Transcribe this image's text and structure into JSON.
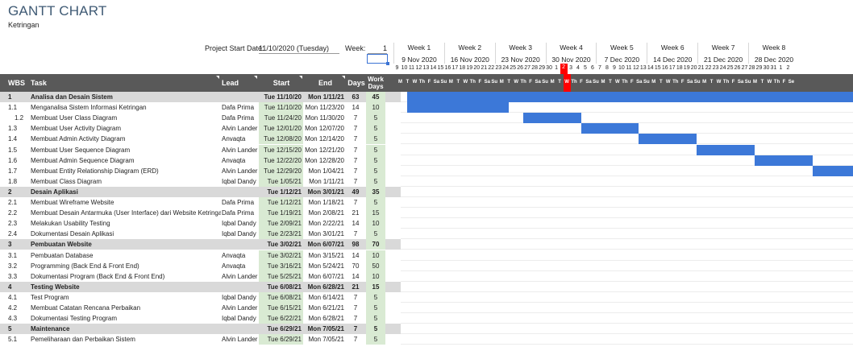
{
  "header": {
    "title": "GANTT CHART",
    "subtitle": "Ketringan",
    "project_start_label": "Project Start Date:",
    "project_start_value": "11/10/2020 (Tuesday)",
    "week_label": "Week:",
    "week_value": "1"
  },
  "weeks": [
    {
      "name": "Week 1",
      "date": "9 Nov 2020"
    },
    {
      "name": "Week 2",
      "date": "16 Nov 2020"
    },
    {
      "name": "Week 3",
      "date": "23 Nov 2020"
    },
    {
      "name": "Week 4",
      "date": "30 Nov 2020"
    },
    {
      "name": "Week 5",
      "date": "7 Dec 2020"
    },
    {
      "name": "Week 6",
      "date": "14 Dec 2020"
    },
    {
      "name": "Week 7",
      "date": "21 Dec 2020"
    },
    {
      "name": "Week 8",
      "date": "28 Dec 2020"
    }
  ],
  "day_numbers": [
    "9",
    "10",
    "11",
    "12",
    "13",
    "14",
    "15",
    "16",
    "17",
    "18",
    "19",
    "20",
    "21",
    "22",
    "23",
    "24",
    "25",
    "26",
    "27",
    "28",
    "29",
    "30",
    "1",
    "2",
    "3",
    "4",
    "5",
    "6",
    "7",
    "8",
    "9",
    "10",
    "11",
    "12",
    "13",
    "14",
    "15",
    "16",
    "17",
    "18",
    "19",
    "20",
    "21",
    "22",
    "23",
    "24",
    "25",
    "26",
    "27",
    "28",
    "29",
    "30",
    "31",
    "1",
    "2"
  ],
  "day_letters": [
    "M",
    "T",
    "W",
    "Th",
    "F",
    "Sa",
    "Su",
    "M",
    "T",
    "W",
    "Th",
    "F",
    "Sa",
    "Su",
    "M",
    "T",
    "W",
    "Th",
    "F",
    "Sa",
    "Su",
    "M",
    "T",
    "W",
    "Th",
    "F",
    "Sa",
    "Su",
    "M",
    "T",
    "W",
    "Th",
    "F",
    "Sa",
    "Su",
    "M",
    "T",
    "W",
    "Th",
    "F",
    "Sa",
    "Su",
    "M",
    "T",
    "W",
    "Th",
    "F",
    "Sa",
    "Su",
    "M",
    "T",
    "W",
    "Th",
    "F",
    "Se"
  ],
  "today_index": 23,
  "columns": {
    "wbs": "WBS",
    "task": "Task",
    "lead": "Lead",
    "start": "Start",
    "end": "End",
    "days": "Days",
    "work_days": "Work Days"
  },
  "rows": [
    {
      "wbs": "1",
      "task": "Analisa dan Desain Sistem",
      "lead": "",
      "start": "Tue 11/10/20",
      "end": "Mon 1/11/21",
      "days": "63",
      "work": "45",
      "phase": true
    },
    {
      "wbs": "1.1",
      "task": "Menganalisa Sistem Informasi Ketringan",
      "lead": "Dafa Prima",
      "start": "Tue 11/10/20",
      "end": "Mon 11/23/20",
      "days": "14",
      "work": "10",
      "bar_start": 0,
      "bar_len": 14
    },
    {
      "wbs": "1.2",
      "task": "Membuat User Class Diagram",
      "lead": "Dafa Prima",
      "start": "Tue 11/24/20",
      "end": "Mon 11/30/20",
      "days": "7",
      "work": "5",
      "bar_start": 16,
      "bar_len": 8,
      "indent": true
    },
    {
      "wbs": "1.3",
      "task": "Membuat User Activity Diagram",
      "lead": "Alvin Lander",
      "start": "Tue 12/01/20",
      "end": "Mon 12/07/20",
      "days": "7",
      "work": "5",
      "bar_start": 24,
      "bar_len": 8
    },
    {
      "wbs": "1.4",
      "task": "Membuat Admin Activity Diagram",
      "lead": "Anvaqta",
      "start": "Tue 12/08/20",
      "end": "Mon 12/14/20",
      "days": "7",
      "work": "5",
      "bar_start": 32,
      "bar_len": 8
    },
    {
      "wbs": "1.5",
      "task": "Membuat User Sequence Diagram",
      "lead": "Alvin Lander",
      "start": "Tue 12/15/20",
      "end": "Mon 12/21/20",
      "days": "7",
      "work": "5",
      "bar_start": 40,
      "bar_len": 8
    },
    {
      "wbs": "1.6",
      "task": "Membuat Admin Sequence Diagram",
      "lead": "Anvaqta",
      "start": "Tue 12/22/20",
      "end": "Mon 12/28/20",
      "days": "7",
      "work": "5",
      "bar_start": 48,
      "bar_len": 8
    },
    {
      "wbs": "1.7",
      "task": "Membuat Entity Relationship Diagram (ERD)",
      "lead": "Alvin Lander",
      "start": "Tue 12/29/20",
      "end": "Mon 1/04/21",
      "days": "7",
      "work": "5",
      "bar_start": 56,
      "bar_len": 6
    },
    {
      "wbs": "1.8",
      "task": "Membuat Class Diagram",
      "lead": "Iqbal Dandy",
      "start": "Tue 1/05/21",
      "end": "Mon 1/11/21",
      "days": "7",
      "work": "5"
    },
    {
      "wbs": "2",
      "task": "Desain Aplikasi",
      "lead": "",
      "start": "Tue 1/12/21",
      "end": "Mon 3/01/21",
      "days": "49",
      "work": "35",
      "phase": true
    },
    {
      "wbs": "2.1",
      "task": "Membuat Wireframe Website",
      "lead": "Dafa Prima",
      "start": "Tue 1/12/21",
      "end": "Mon 1/18/21",
      "days": "7",
      "work": "5"
    },
    {
      "wbs": "2.2",
      "task": "Membuat Desain Antarmuka (User Interface) dari Website Ketringan",
      "lead": "Dafa Prima",
      "start": "Tue 1/19/21",
      "end": "Mon 2/08/21",
      "days": "21",
      "work": "15"
    },
    {
      "wbs": "2.3",
      "task": "Melakukan Usability Testing",
      "lead": "Iqbal Dandy",
      "start": "Tue 2/09/21",
      "end": "Mon 2/22/21",
      "days": "14",
      "work": "10"
    },
    {
      "wbs": "2.4",
      "task": "Dokumentasi Desain Aplikasi",
      "lead": "Iqbal Dandy",
      "start": "Tue 2/23/21",
      "end": "Mon 3/01/21",
      "days": "7",
      "work": "5"
    },
    {
      "wbs": "3",
      "task": "Pembuatan Website",
      "lead": "",
      "start": "Tue 3/02/21",
      "end": "Mon 6/07/21",
      "days": "98",
      "work": "70",
      "phase": true
    },
    {
      "wbs": "3.1",
      "task": "Pembuatan Database",
      "lead": "Anvaqta",
      "start": "Tue 3/02/21",
      "end": "Mon 3/15/21",
      "days": "14",
      "work": "10"
    },
    {
      "wbs": "3.2",
      "task": "Programming (Back End & Front End)",
      "lead": "Anvaqta",
      "start": "Tue 3/16/21",
      "end": "Mon 5/24/21",
      "days": "70",
      "work": "50"
    },
    {
      "wbs": "3.3",
      "task": "Dokumentasi Program (Back End & Front End)",
      "lead": "Alvin Lander",
      "start": "Tue 5/25/21",
      "end": "Mon 6/07/21",
      "days": "14",
      "work": "10"
    },
    {
      "wbs": "4",
      "task": "Testing Website",
      "lead": "",
      "start": "Tue 6/08/21",
      "end": "Mon 6/28/21",
      "days": "21",
      "work": "15",
      "phase": true
    },
    {
      "wbs": "4.1",
      "task": "Test Program",
      "lead": "Iqbal Dandy",
      "start": "Tue 6/08/21",
      "end": "Mon 6/14/21",
      "days": "7",
      "work": "5"
    },
    {
      "wbs": "4.2",
      "task": "Membuat Catatan Rencana Perbaikan",
      "lead": "Alvin Lander",
      "start": "Tue 6/15/21",
      "end": "Mon 6/21/21",
      "days": "7",
      "work": "5"
    },
    {
      "wbs": "4.3",
      "task": "Dokumentasi Testing Program",
      "lead": "Iqbal Dandy",
      "start": "Tue 6/22/21",
      "end": "Mon 6/28/21",
      "days": "7",
      "work": "5"
    },
    {
      "wbs": "5",
      "task": "Maintenance",
      "lead": "",
      "start": "Tue 6/29/21",
      "end": "Mon 7/05/21",
      "days": "7",
      "work": "5",
      "phase": true
    },
    {
      "wbs": "5.1",
      "task": "Pemeliharaan dan Perbaikan Sistem",
      "lead": "Alvin Lander",
      "start": "Tue 6/29/21",
      "end": "Mon 7/05/21",
      "days": "7",
      "work": "5"
    }
  ],
  "phase_bar": {
    "row": 0,
    "bar_start": 0,
    "bar_len": 63
  },
  "colors": {
    "bar": "#3c78d8",
    "header_bg": "#595959",
    "phase_bg": "#d9d9d9",
    "start_bg": "#d9ead3",
    "today": "#ff0000"
  }
}
